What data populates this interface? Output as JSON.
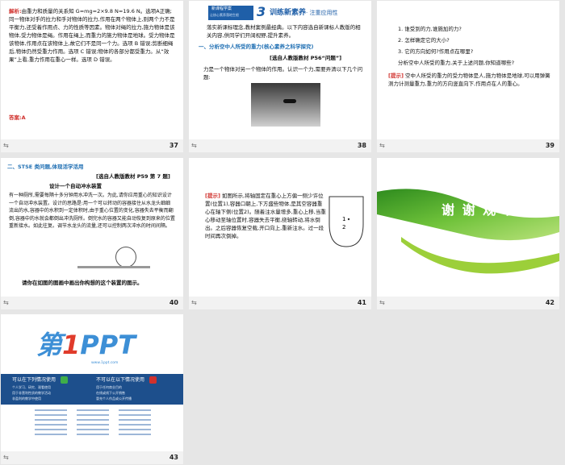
{
  "slides": [
    {
      "number": "37",
      "jiexi": "解析:",
      "body": "由重力和质量的关系知 G=mg=2×9.8 N=19.6 N。选项A正确;同一物体对手的拉力和手对物体的拉力,作用在两个物体上,则两个力不是平衡力,还受着作用点、力的性质等因素。物体对绳的拉力,施力物体是该物体,受力物体是绳。作用在绳上,而重力的施力物体是地球。受力物体是该物体,作用点在该物体上,故它们不是同一个力。选项 B 错误;剪断细绳后,物体仍然受重力作用。选项 C 错误;物体的各部分都受重力。从“效果”上看,重力作用在重心一样。选项 D 错误。",
      "answer_label": "答案:",
      "answer": "A"
    },
    {
      "number": "38",
      "banner_small": "新课程学案",
      "banner_sub": "让核心素养落地生根",
      "banner_num": "3",
      "banner_title": "训练新素养",
      "banner_tail": "· 注重应用性",
      "intro": "落实新课标理念,教材案例最经典。以下内容选自新课标人教版的相关内容,供同学们开阔视野,提升素养。",
      "section": "一、分析空中人所受的重力(核心素养之科学探究)",
      "source": "[选自人教版教材 P56“问题”]",
      "q": "力是一个物体对另一个物体的作用。认识一个力,需要弄清以下几个问题:"
    },
    {
      "number": "39",
      "items": [
        "1. 谁受到的力,谁施加的力?",
        "2. 怎样确定它的大小?",
        "3. 它的方向如何?作用点在哪里?"
      ],
      "prompt": "分析空中人所受的重力,关于上述问题,你知道哪些?",
      "tip": "[提示]",
      "answer": "空中人所受的重力的受力物体是人,施力物体是地球,可以用弹簧测力计测量重力,重力的方向竖直向下,作用点在人的重心。"
    },
    {
      "number": "40",
      "section": "二、STSE 类问题,体现活学活用",
      "source": "[选自人教版教材 P59 第 7 题]",
      "title": "设计一个自动冲水装置",
      "body": "有一种厕所,需要每隔十多分钟用水冲洗一次。为此,请你应用重心的知识设计一个自动冲水装置。设计的思路是:用一个可以转动的容器接住从水龙头细细流出的水,容器中的水积到一定体积时,由于重心位置的变化,容器失去平衡而翻倒,容器中的水就会都倒出冲洗厕所。倒完水的容器又能自动恢复到原来的位置重新接水。如此往复。调节水龙头的流量,还可以控制两次冲水的时间间隔。",
      "footer": "请你在如图的图画中画出你构想的这个装置的图示。"
    },
    {
      "number": "41",
      "tip": "[提示]",
      "body": "如图所示,将轴固定在重心上方偏一侧少许位置(位置1),容器口朝上,下方盛些物体,是其空容器重心在轴下侧(位置2)。随着注水量增多,重心上移,当重心移动至轴位置时,容器失去平衡,绕轴转动,将水倒出。之后容器恢复空载,开口向上,重新注水。过一段时间再次倒掉。"
    },
    {
      "number": "42",
      "thanks": "谢 谢 观 看"
    },
    {
      "number": "43",
      "logo_di": "第",
      "logo_one": "1",
      "logo_ppt": "PPT",
      "logo_url": "www.1ppt.com",
      "can_title": "可以在下列情况使用",
      "can_items": [
        "个人学习、研究、观看使用",
        "用于非营利性质的教学活动",
        "非盈利的教学中使用"
      ],
      "cannot_title": "不可以在以下情况使用",
      "cannot_items": [
        "用于任何商业目的",
        "在线或线下公开销售",
        "冒充个人作品或公开传播"
      ],
      "colors": {
        "check": "#3fae49",
        "cross": "#d0312d",
        "logo_blue": "#3d8fd6",
        "logo_red": "#e03b2b"
      }
    }
  ]
}
